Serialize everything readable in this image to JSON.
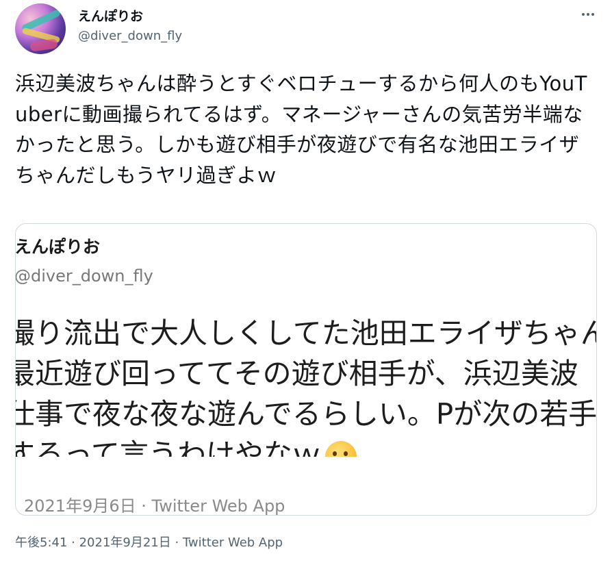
{
  "author": {
    "display_name": "えんぽりお",
    "handle": "@diver_down_fly"
  },
  "menu": {
    "icon": "more-horizontal-icon"
  },
  "tweet": {
    "text": "浜辺美波ちゃんは酔うとすぐベロチューするから何人のもYouTuberに動画撮られてるはず。マネージャーさんの気苦労半端なかったと思う。しかも遊び相手が夜遊びで有名な池田エライザちゃんだしもうヤリ過ぎよｗ"
  },
  "quoted_image": {
    "display_name": "えんぽりお",
    "handle": "@diver_down_fly",
    "lines": [
      "撮り流出で大人しくしてた池田エライザちゃん",
      "最近遊び回っててその遊び相手が、浜辺美波",
      "仕事で夜な夜な遊んでるらしい。Pが次の若手",
      "するって言うわけやなｗ"
    ],
    "emoji": "thinking-face-icon",
    "meta": "2021年9月6日 · Twitter Web App"
  },
  "timestamp": "午後5:41 · 2021年9月21日 · Twitter Web App"
}
